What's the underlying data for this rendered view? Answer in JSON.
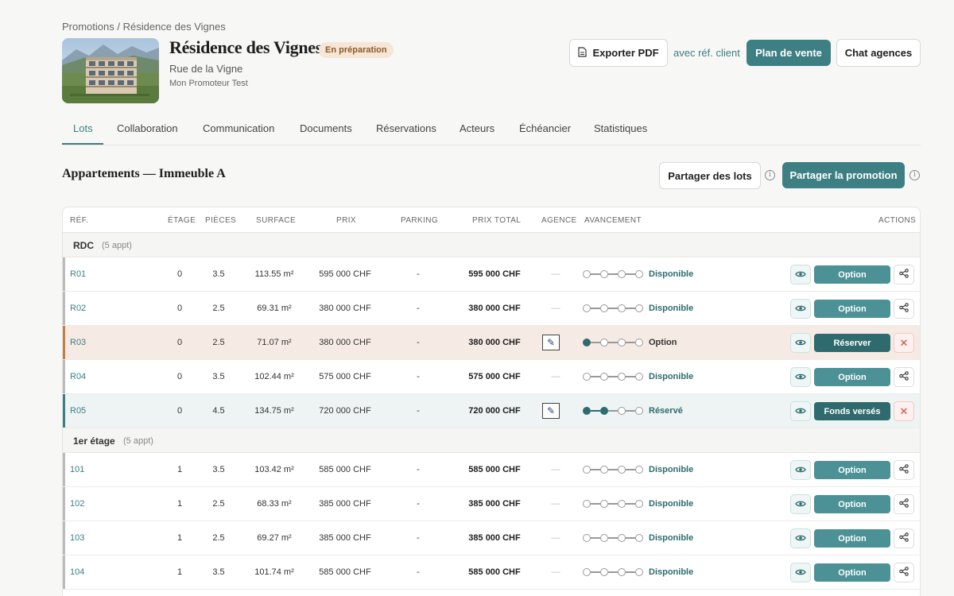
{
  "breadcrumb": "Promotions / Résidence des Vignes",
  "project": {
    "title": "Résidence des Vignes",
    "badge": "En préparation",
    "address": "Rue de la Vigne",
    "promoter": "Mon Promoteur Test"
  },
  "header_actions": {
    "export_pdf": "Exporter PDF",
    "client_ref": "avec réf. client",
    "sale_plan": "Plan de vente",
    "chat": "Chat agences"
  },
  "tabs": [
    "Lots",
    "Collaboration",
    "Communication",
    "Documents",
    "Réservations",
    "Acteurs",
    "Échéancier",
    "Statistiques"
  ],
  "section": {
    "title": "Appartements — Immeuble A",
    "share_lots": "Partager des lots",
    "share_promotion": "Partager la promotion"
  },
  "table": {
    "headers": [
      "Réf.",
      "Étage",
      "Pièces",
      "Surface",
      "Prix",
      "Parking",
      "Prix total",
      "Agence",
      "Avancement",
      "Actions"
    ],
    "groups": [
      {
        "label": "RDC",
        "count": "(5 appt)",
        "rows": [
          {
            "ref": "R01",
            "floor": "0",
            "rooms": "3.5",
            "surface": "113.55 m²",
            "price": "595 000 CHF",
            "parking": "-",
            "total": "595 000 CHF",
            "agency": "—",
            "step": 0,
            "status": "Disponible",
            "action": "Option",
            "state": "available"
          },
          {
            "ref": "R02",
            "floor": "0",
            "rooms": "2.5",
            "surface": "69.31 m²",
            "price": "380 000 CHF",
            "parking": "-",
            "total": "380 000 CHF",
            "agency": "—",
            "step": 0,
            "status": "Disponible",
            "action": "Option",
            "state": "available"
          },
          {
            "ref": "R03",
            "floor": "0",
            "rooms": "2.5",
            "surface": "71.07 m²",
            "price": "380 000 CHF",
            "parking": "-",
            "total": "380 000 CHF",
            "agency": "logo",
            "step": 1,
            "status": "Option",
            "action": "Réserver",
            "state": "option"
          },
          {
            "ref": "R04",
            "floor": "0",
            "rooms": "3.5",
            "surface": "102.44 m²",
            "price": "575 000 CHF",
            "parking": "-",
            "total": "575 000 CHF",
            "agency": "—",
            "step": 0,
            "status": "Disponible",
            "action": "Option",
            "state": "available"
          },
          {
            "ref": "R05",
            "floor": "0",
            "rooms": "4.5",
            "surface": "134.75 m²",
            "price": "720 000 CHF",
            "parking": "-",
            "total": "720 000 CHF",
            "agency": "logo",
            "step": 2,
            "status": "Réservé",
            "action": "Fonds versés",
            "state": "reserved"
          }
        ]
      },
      {
        "label": "1er étage",
        "count": "(5 appt)",
        "rows": [
          {
            "ref": "101",
            "floor": "1",
            "rooms": "3.5",
            "surface": "103.42 m²",
            "price": "585 000 CHF",
            "parking": "-",
            "total": "585 000 CHF",
            "agency": "—",
            "step": 0,
            "status": "Disponible",
            "action": "Option",
            "state": "available"
          },
          {
            "ref": "102",
            "floor": "1",
            "rooms": "2.5",
            "surface": "68.33 m²",
            "price": "385 000 CHF",
            "parking": "-",
            "total": "385 000 CHF",
            "agency": "—",
            "step": 0,
            "status": "Disponible",
            "action": "Option",
            "state": "available"
          },
          {
            "ref": "103",
            "floor": "1",
            "rooms": "2.5",
            "surface": "69.27 m²",
            "price": "385 000 CHF",
            "parking": "-",
            "total": "385 000 CHF",
            "agency": "—",
            "step": 0,
            "status": "Disponible",
            "action": "Option",
            "state": "available"
          },
          {
            "ref": "104",
            "floor": "1",
            "rooms": "3.5",
            "surface": "101.74 m²",
            "price": "585 000 CHF",
            "parking": "-",
            "total": "585 000 CHF",
            "agency": "—",
            "step": 0,
            "status": "Disponible",
            "action": "Option",
            "state": "available"
          }
        ]
      }
    ]
  },
  "icons": {
    "pdf": "document-icon",
    "info": "info-icon",
    "view": "eye-icon",
    "share": "share-icon",
    "cancel": "close-icon"
  },
  "colors": {
    "accent": "#3d7f83",
    "option_row": "#f6ebe4",
    "reserved_row": "#eef4f4",
    "badge_bg": "#f6e6d6"
  }
}
